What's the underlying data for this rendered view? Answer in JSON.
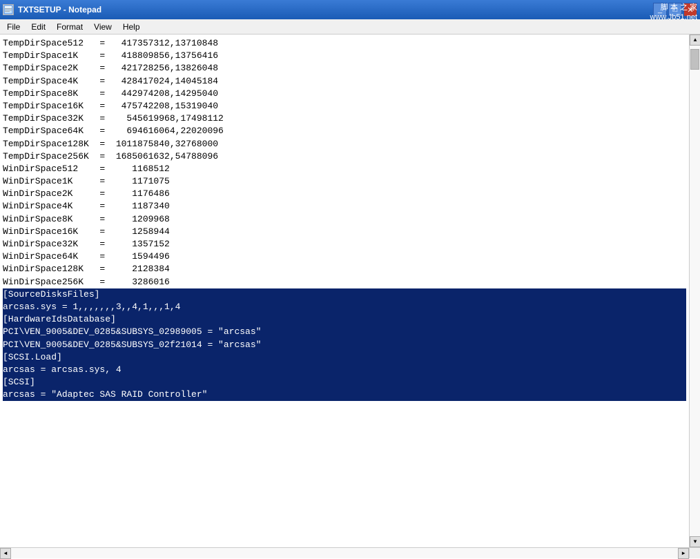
{
  "titlebar": {
    "icon": "N",
    "title": "TXTSETUP - Notepad",
    "watermark_line1": "脚 本 之 家",
    "watermark_line2": "www.Jb51.net",
    "minimize": "_",
    "maximize": "□",
    "close": "✕"
  },
  "menubar": {
    "items": [
      {
        "label": "File",
        "id": "file"
      },
      {
        "label": "Edit",
        "id": "edit"
      },
      {
        "label": "Format",
        "id": "format"
      },
      {
        "label": "View",
        "id": "view"
      },
      {
        "label": "Help",
        "id": "help"
      }
    ]
  },
  "content": {
    "lines": [
      {
        "text": "",
        "highlight": false
      },
      {
        "text": "",
        "highlight": false
      },
      {
        "text": "",
        "highlight": false
      },
      {
        "text": "",
        "highlight": false
      },
      {
        "text": "",
        "highlight": false
      },
      {
        "text": "",
        "highlight": false
      },
      {
        "text": "",
        "highlight": false
      },
      {
        "text": "",
        "highlight": false
      },
      {
        "text": "",
        "highlight": false
      },
      {
        "text": "",
        "highlight": false
      },
      {
        "text": "",
        "highlight": false
      },
      {
        "text": "",
        "highlight": false
      },
      {
        "text": "",
        "highlight": false
      },
      {
        "text": "TempDirSpace512   =   417357312,13710848",
        "highlight": false
      },
      {
        "text": "TempDirSpace1K    =   418809856,13756416",
        "highlight": false
      },
      {
        "text": "TempDirSpace2K    =   421728256,13826048",
        "highlight": false
      },
      {
        "text": "TempDirSpace4K    =   428417024,14045184",
        "highlight": false
      },
      {
        "text": "TempDirSpace8K    =   442974208,14295040",
        "highlight": false
      },
      {
        "text": "TempDirSpace16K   =   475742208,15319040",
        "highlight": false
      },
      {
        "text": "TempDirSpace32K   =    545619968,17498112",
        "highlight": false
      },
      {
        "text": "TempDirSpace64K   =    694616064,22020096",
        "highlight": false
      },
      {
        "text": "TempDirSpace128K  =  1011875840,32768000",
        "highlight": false
      },
      {
        "text": "TempDirSpace256K  =  1685061632,54788096",
        "highlight": false
      },
      {
        "text": "",
        "highlight": false
      },
      {
        "text": "",
        "highlight": false
      },
      {
        "text": "",
        "highlight": false
      },
      {
        "text": "WinDirSpace512    =     1168512",
        "highlight": false
      },
      {
        "text": "WinDirSpace1K     =     1171075",
        "highlight": false
      },
      {
        "text": "WinDirSpace2K     =     1176486",
        "highlight": false
      },
      {
        "text": "WinDirSpace4K     =     1187340",
        "highlight": false
      },
      {
        "text": "WinDirSpace8K     =     1209968",
        "highlight": false
      },
      {
        "text": "WinDirSpace16K    =     1258944",
        "highlight": false
      },
      {
        "text": "WinDirSpace32K    =     1357152",
        "highlight": false
      },
      {
        "text": "WinDirSpace64K    =     1594496",
        "highlight": false
      },
      {
        "text": "WinDirSpace128K   =     2128384",
        "highlight": false
      },
      {
        "text": "WinDirSpace256K   =     3286016",
        "highlight": false
      },
      {
        "text": "[SourceDisksFiles]",
        "highlight": true
      },
      {
        "text": "arcsas.sys = 1,,,,,,,3,,4,1,,,1,4",
        "highlight": true
      },
      {
        "text": "",
        "highlight": false
      },
      {
        "text": "[HardwareIdsDatabase]",
        "highlight": true
      },
      {
        "text": "PCI\\VEN_9005&DEV_0285&SUBSYS_02989005 = \"arcsas\"",
        "highlight": true
      },
      {
        "text": "PCI\\VEN_9005&DEV_0285&SUBSYS_02f21014 = \"arcsas\"",
        "highlight": true
      },
      {
        "text": "",
        "highlight": false
      },
      {
        "text": "[SCSI.Load]",
        "highlight": true
      },
      {
        "text": "arcsas = arcsas.sys, 4",
        "highlight": true
      },
      {
        "text": "",
        "highlight": false
      },
      {
        "text": "[SCSI]",
        "highlight": true
      },
      {
        "text": "arcsas = \"Adaptec SAS RAID Controller\"",
        "highlight": true
      },
      {
        "text": "",
        "highlight": false
      }
    ]
  }
}
